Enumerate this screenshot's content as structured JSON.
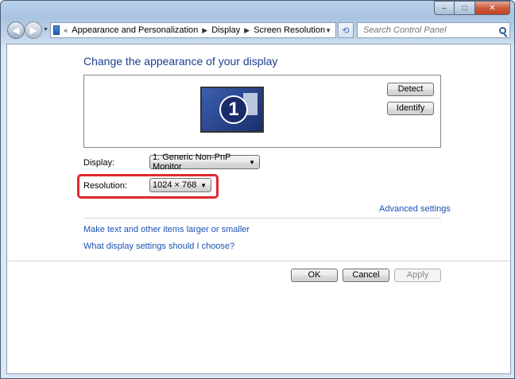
{
  "window": {
    "caption": {
      "minimize": "–",
      "maximize": "□",
      "close": "✕"
    }
  },
  "nav": {
    "back_icon": "◀",
    "forward_icon": "▶",
    "history_dropdown_icon": "▼",
    "breadcrumb_overflow": "«",
    "breadcrumbs": [
      "Appearance and Personalization",
      "Display",
      "Screen Resolution"
    ],
    "separator": "▶",
    "address_dropdown_icon": "▼",
    "refresh_icon": "⟲"
  },
  "search": {
    "placeholder": "Search Control Panel"
  },
  "main": {
    "title": "Change the appearance of your display",
    "preview": {
      "monitor_number": "1"
    },
    "detect_label": "Detect",
    "identify_label": "Identify",
    "display_label": "Display:",
    "display_value": "1. Generic Non-PnP Monitor",
    "resolution_label": "Resolution:",
    "resolution_value": "1024 × 768",
    "advanced_settings": "Advanced settings",
    "links": [
      "Make text and other items larger or smaller",
      "What display settings should I choose?"
    ]
  },
  "footer": {
    "ok": "OK",
    "cancel": "Cancel",
    "apply": "Apply"
  },
  "colors": {
    "title": "#1e3d8f",
    "link": "#1a52b5",
    "highlight": "#e0282e",
    "close": "#c24526"
  }
}
